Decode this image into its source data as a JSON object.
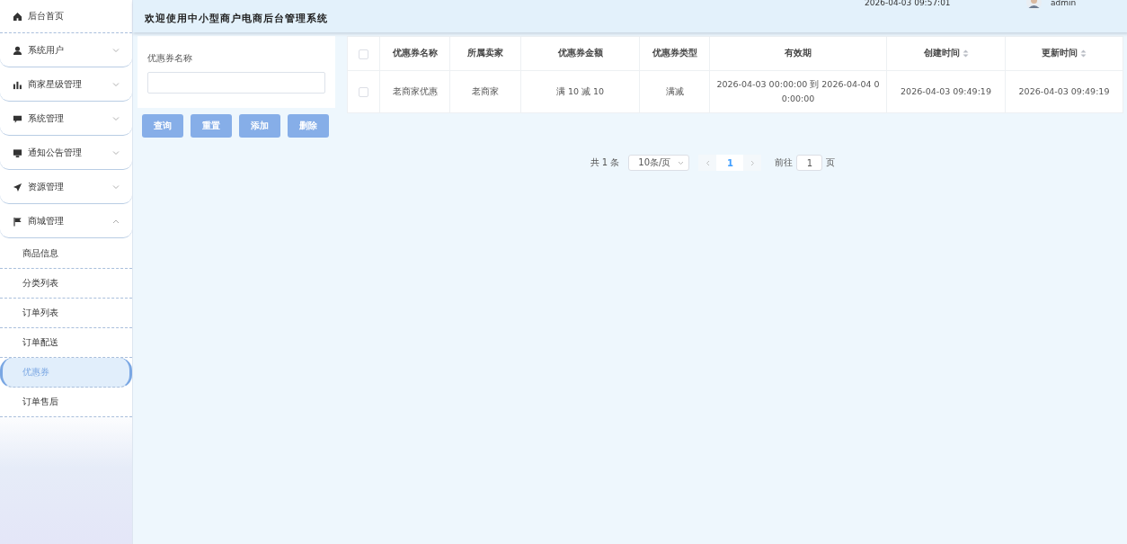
{
  "sidebar": {
    "items": [
      {
        "label": "后台首页",
        "expandable": false
      },
      {
        "label": "系统用户",
        "expandable": true,
        "expanded": false
      },
      {
        "label": "商家星级管理",
        "expandable": true,
        "expanded": false
      },
      {
        "label": "系统管理",
        "expandable": true,
        "expanded": false
      },
      {
        "label": "通知公告管理",
        "expandable": true,
        "expanded": false
      },
      {
        "label": "资源管理",
        "expandable": true,
        "expanded": false
      },
      {
        "label": "商城管理",
        "expandable": true,
        "expanded": true,
        "children": [
          {
            "label": "商品信息",
            "selected": false
          },
          {
            "label": "分类列表",
            "selected": false
          },
          {
            "label": "订单列表",
            "selected": false
          },
          {
            "label": "订单配送",
            "selected": false
          },
          {
            "label": "优惠券",
            "selected": true
          },
          {
            "label": "订单售后",
            "selected": false
          }
        ]
      }
    ]
  },
  "header": {
    "title": "欢迎使用中小型商户电商后台管理系统",
    "time": "2026-04-03 09:57:01",
    "user": "admin"
  },
  "search": {
    "label": "优惠券名称"
  },
  "buttons": [
    "查询",
    "重置",
    "添加",
    "删除"
  ],
  "table": {
    "all_checked": false,
    "columns": [
      {
        "label": "优惠券名称",
        "sortable": false
      },
      {
        "label": "所属卖家",
        "sortable": false
      },
      {
        "label": "优惠券金额",
        "sortable": false
      },
      {
        "label": "优惠券类型",
        "sortable": false
      },
      {
        "label": "有效期",
        "sortable": false
      },
      {
        "label": "创建时间",
        "sortable": true
      },
      {
        "label": "更新时间",
        "sortable": true
      }
    ],
    "rows": [
      {
        "checked": false,
        "cells": [
          "老商家优惠",
          "老商家",
          "满 10 减 10",
          "满减",
          "2026-04-03 00:00:00 到 2026-04-04 00:00:00",
          "2026-04-03 09:49:19",
          "2026-04-03 09:49:19"
        ]
      }
    ]
  },
  "pagination": {
    "total": "共 1 条",
    "page_size": "10条/页",
    "pages": [
      {
        "label": "1",
        "selected": true
      }
    ],
    "goto_label": "前往",
    "goto_value": "1",
    "page_suffix": "页"
  }
}
